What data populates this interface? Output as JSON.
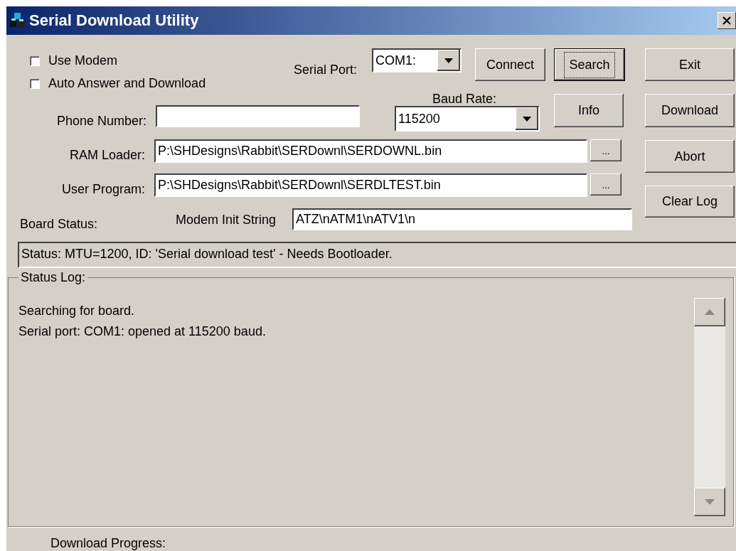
{
  "window": {
    "title": "Serial Download Utility"
  },
  "options": [
    {
      "label": "Use Modem",
      "checked": false
    },
    {
      "label": "Auto Answer and Download",
      "checked": false
    }
  ],
  "serial_port": {
    "label": "Serial Port:",
    "value": "COM1:"
  },
  "baud_rate": {
    "label": "Baud Rate:",
    "value": "115200"
  },
  "phone_number": {
    "label": "Phone Number:"
  },
  "ram_loader": {
    "label": "RAM Loader:",
    "value": "P:\\SHDesigns\\Rabbit\\SERDownl\\SERDOWNL.bin",
    "browse": "..."
  },
  "user_program": {
    "label": "User Program:",
    "value": "P:\\SHDesigns\\Rabbit\\SERDownl\\SERDLTEST.bin",
    "browse": "..."
  },
  "board_status": {
    "label": "Board Status:"
  },
  "modem_init": {
    "label": "Modem Init String",
    "value": "ATZ\\nATM1\\nATV1\\n"
  },
  "status": "Status: MTU=1200, ID: 'Serial download test' - Needs Bootloader.",
  "buttons": {
    "connect": "Connect",
    "search": "Search",
    "info": "Info",
    "exit": "Exit",
    "download": "Download",
    "abort": "Abort",
    "clear_log": "Clear Log"
  },
  "status_log": {
    "label": "Status Log:",
    "lines": [
      "Searching for board.",
      "Serial port: COM1: opened at 115200 baud."
    ]
  },
  "download_progress": {
    "label": "Download Progress:"
  }
}
